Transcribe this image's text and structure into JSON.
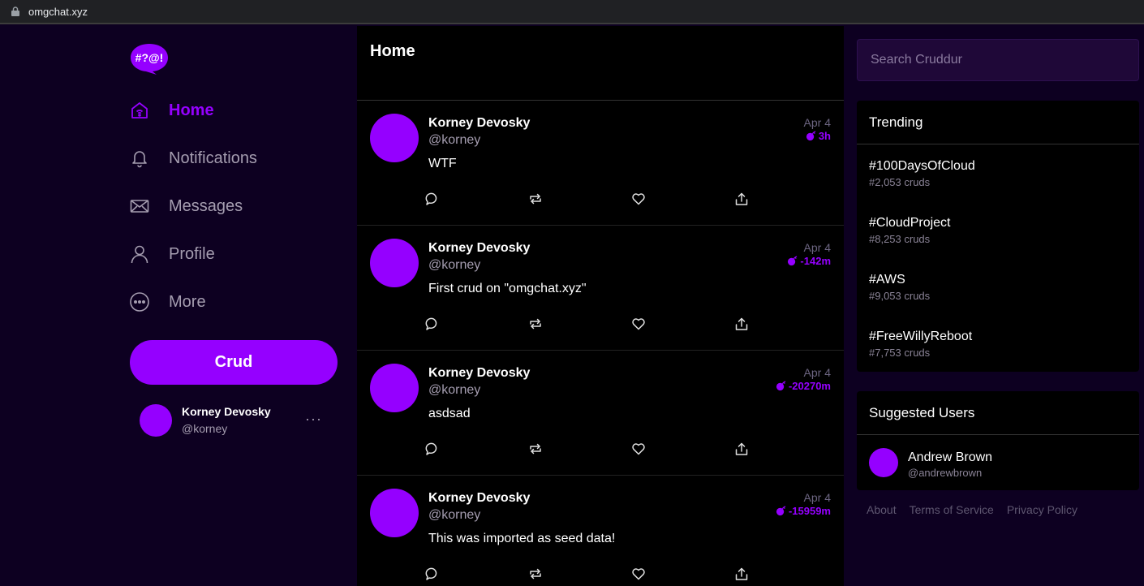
{
  "browser": {
    "url": "omgchat.xyz"
  },
  "brand": {
    "logo_text": "#?@!",
    "accent": "#9500ff"
  },
  "nav": {
    "items": [
      {
        "label": "Home",
        "icon": "home-icon",
        "active": true
      },
      {
        "label": "Notifications",
        "icon": "bell-icon",
        "active": false
      },
      {
        "label": "Messages",
        "icon": "envelope-icon",
        "active": false
      },
      {
        "label": "Profile",
        "icon": "person-icon",
        "active": false
      },
      {
        "label": "More",
        "icon": "more-icon",
        "active": false
      }
    ],
    "crud_button": "Crud"
  },
  "current_user": {
    "name": "Korney Devosky",
    "handle": "@korney",
    "menu": "···"
  },
  "feed": {
    "title": "Home",
    "posts": [
      {
        "name": "Korney Devosky",
        "handle": "@korney",
        "text": "WTF",
        "date": "Apr 4",
        "expires": "3h"
      },
      {
        "name": "Korney Devosky",
        "handle": "@korney",
        "text": "First crud on \"omgchat.xyz\"",
        "date": "Apr 4",
        "expires": "-142m"
      },
      {
        "name": "Korney Devosky",
        "handle": "@korney",
        "text": "asdsad",
        "date": "Apr 4",
        "expires": "-20270m"
      },
      {
        "name": "Korney Devosky",
        "handle": "@korney",
        "text": "This was imported as seed data!",
        "date": "Apr 4",
        "expires": "-15959m"
      }
    ]
  },
  "search": {
    "placeholder": "Search Cruddur"
  },
  "trending": {
    "title": "Trending",
    "items": [
      {
        "tag": "#100DaysOfCloud",
        "count": "#2,053 cruds"
      },
      {
        "tag": "#CloudProject",
        "count": "#8,253 cruds"
      },
      {
        "tag": "#AWS",
        "count": "#9,053 cruds"
      },
      {
        "tag": "#FreeWillyReboot",
        "count": "#7,753 cruds"
      }
    ]
  },
  "suggested": {
    "title": "Suggested Users",
    "users": [
      {
        "name": "Andrew Brown",
        "handle": "@andrewbrown"
      }
    ]
  },
  "footer": {
    "about": "About",
    "terms": "Terms of Service",
    "privacy": "Privacy Policy"
  }
}
